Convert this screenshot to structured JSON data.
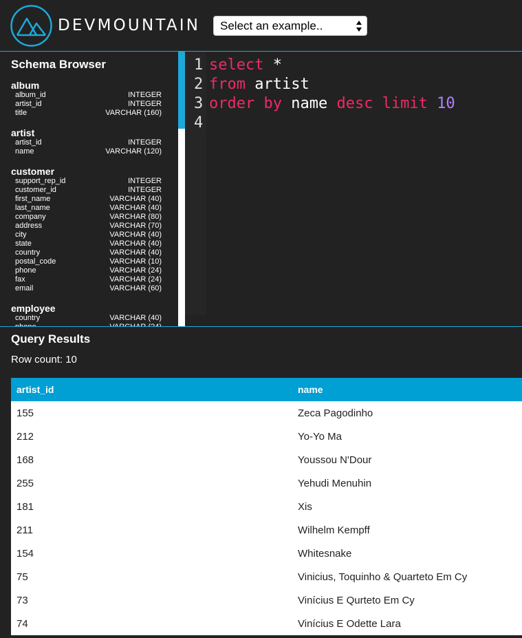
{
  "header": {
    "brand": "DEVMOUNTAIN",
    "select_label": "Select an example.."
  },
  "schema": {
    "title": "Schema Browser",
    "tables": [
      {
        "name": "album",
        "columns": [
          {
            "name": "album_id",
            "type": "INTEGER"
          },
          {
            "name": "artist_id",
            "type": "INTEGER"
          },
          {
            "name": "title",
            "type": "VARCHAR (160)"
          }
        ]
      },
      {
        "name": "artist",
        "columns": [
          {
            "name": "artist_id",
            "type": "INTEGER"
          },
          {
            "name": "name",
            "type": "VARCHAR (120)"
          }
        ]
      },
      {
        "name": "customer",
        "columns": [
          {
            "name": "support_rep_id",
            "type": "INTEGER"
          },
          {
            "name": "customer_id",
            "type": "INTEGER"
          },
          {
            "name": "first_name",
            "type": "VARCHAR (40)"
          },
          {
            "name": "last_name",
            "type": "VARCHAR (40)"
          },
          {
            "name": "company",
            "type": "VARCHAR (80)"
          },
          {
            "name": "address",
            "type": "VARCHAR (70)"
          },
          {
            "name": "city",
            "type": "VARCHAR (40)"
          },
          {
            "name": "state",
            "type": "VARCHAR (40)"
          },
          {
            "name": "country",
            "type": "VARCHAR (40)"
          },
          {
            "name": "postal_code",
            "type": "VARCHAR (10)"
          },
          {
            "name": "phone",
            "type": "VARCHAR (24)"
          },
          {
            "name": "fax",
            "type": "VARCHAR (24)"
          },
          {
            "name": "email",
            "type": "VARCHAR (60)"
          }
        ]
      },
      {
        "name": "employee",
        "columns": [
          {
            "name": "country",
            "type": "VARCHAR (40)"
          },
          {
            "name": "phone",
            "type": "VARCHAR (24)"
          }
        ]
      }
    ]
  },
  "editor": {
    "line_numbers": [
      "1",
      "2",
      "3",
      "4"
    ],
    "tokens": {
      "select": "select",
      "star": " *",
      "from": "from",
      "artist": " artist",
      "order_by": "order by",
      "name": " name ",
      "desc": "desc",
      "limit": " limit ",
      "ten": "10"
    }
  },
  "results": {
    "title": "Query Results",
    "row_count": "Row count: 10",
    "columns": [
      "artist_id",
      "name"
    ],
    "rows": [
      [
        "155",
        "Zeca Pagodinho"
      ],
      [
        "212",
        "Yo-Yo Ma"
      ],
      [
        "168",
        "Youssou N'Dour"
      ],
      [
        "255",
        "Yehudi Menuhin"
      ],
      [
        "181",
        "Xis"
      ],
      [
        "211",
        "Wilhelm Kempff"
      ],
      [
        "154",
        "Whitesnake"
      ],
      [
        "75",
        "Vinicius, Toquinho & Quarteto Em Cy"
      ],
      [
        "73",
        "Vinícius E Qurteto Em Cy"
      ],
      [
        "74",
        "Vinícius E Odette Lara"
      ]
    ]
  },
  "colors": {
    "accent": "#1da9d8",
    "table_header": "#009fd4",
    "keyword": "#f02a66",
    "number": "#ae81ff",
    "background": "#222222"
  }
}
